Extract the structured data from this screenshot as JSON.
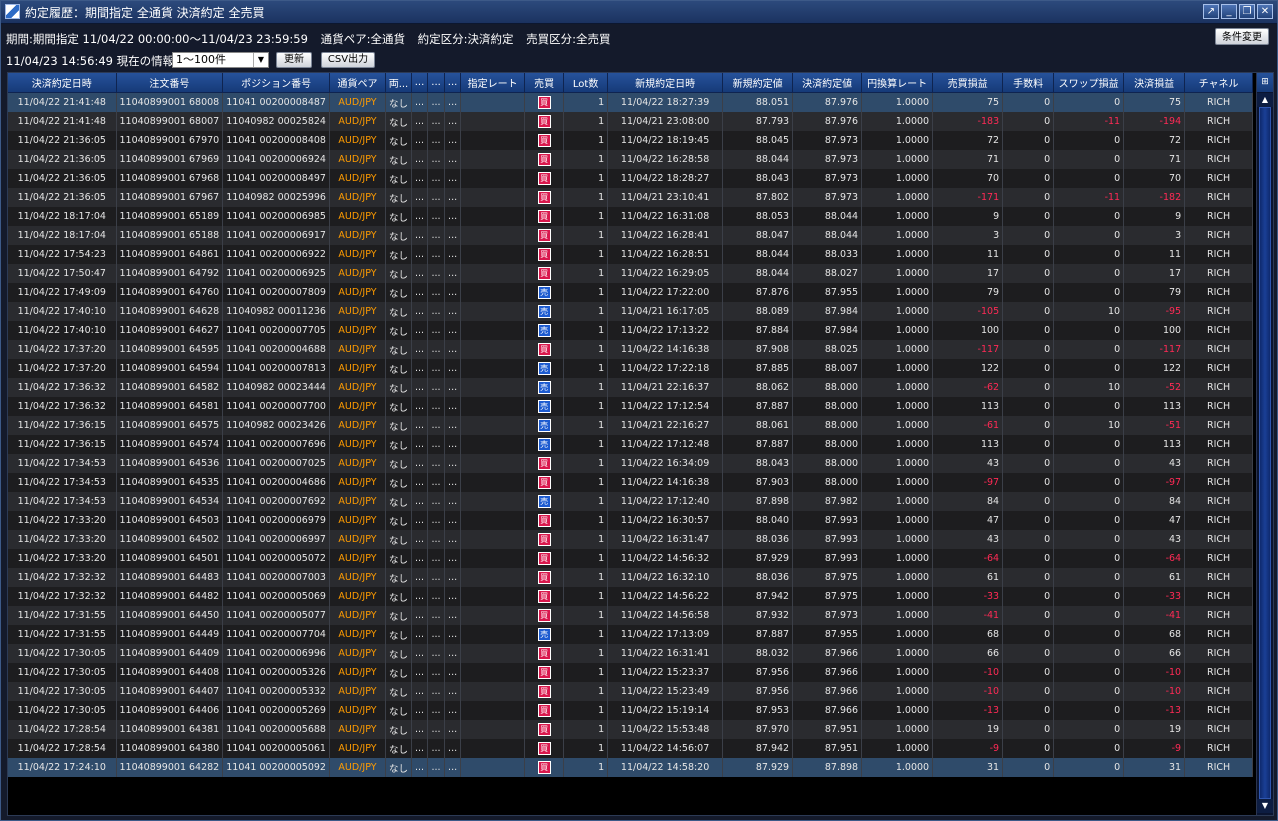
{
  "window": {
    "title": "約定履歴：期間指定 全通貨 決済約定 全売買",
    "buttons": [
      "↗",
      "_",
      "❐",
      "✕"
    ]
  },
  "info": {
    "period": "期間:期間指定  11/04/22 00:00:00〜11/04/23 23:59:59",
    "currency": "通貨ペア:全通貨",
    "contract_type": "約定区分:決済約定",
    "trade_type": "売買区分:全売買",
    "current": "11/04/23 14:56:49 現在の情報",
    "range": "1〜100件",
    "refresh_label": "更新",
    "csv_label": "CSV出力",
    "condition_label": "条件変更"
  },
  "table": {
    "columns": [
      "決済約定日時",
      "注文番号",
      "ポジション番号",
      "通貨ペア",
      "両...",
      "...",
      "...",
      "...",
      "指定レート",
      "売買",
      "Lot数",
      "新規約定日時",
      "新規約定値",
      "決済約定値",
      "円換算レート",
      "売買損益",
      "手数料",
      "スワップ損益",
      "決済損益",
      "チャネル"
    ],
    "rows": [
      [
        "11/04/22 21:41:48",
        "11040899001 68008",
        "11041 00200008487",
        "AUD/JPY",
        "なし",
        "...",
        "...",
        "...",
        "",
        "買",
        "1",
        "11/04/22 18:27:39",
        "88.051",
        "87.976",
        "1.0000",
        "75",
        "0",
        "0",
        "75",
        "RICH"
      ],
      [
        "11/04/22 21:41:48",
        "11040899001 68007",
        "11040982 00025824",
        "AUD/JPY",
        "なし",
        "...",
        "...",
        "...",
        "",
        "買",
        "1",
        "11/04/21 23:08:00",
        "87.793",
        "87.976",
        "1.0000",
        "-183",
        "0",
        "-11",
        "-194",
        "RICH"
      ],
      [
        "11/04/22 21:36:05",
        "11040899001 67970",
        "11041 00200008408",
        "AUD/JPY",
        "なし",
        "...",
        "...",
        "...",
        "",
        "買",
        "1",
        "11/04/22 18:19:45",
        "88.045",
        "87.973",
        "1.0000",
        "72",
        "0",
        "0",
        "72",
        "RICH"
      ],
      [
        "11/04/22 21:36:05",
        "11040899001 67969",
        "11041 00200006924",
        "AUD/JPY",
        "なし",
        "...",
        "...",
        "...",
        "",
        "買",
        "1",
        "11/04/22 16:28:58",
        "88.044",
        "87.973",
        "1.0000",
        "71",
        "0",
        "0",
        "71",
        "RICH"
      ],
      [
        "11/04/22 21:36:05",
        "11040899001 67968",
        "11041 00200008497",
        "AUD/JPY",
        "なし",
        "...",
        "...",
        "...",
        "",
        "買",
        "1",
        "11/04/22 18:28:27",
        "88.043",
        "87.973",
        "1.0000",
        "70",
        "0",
        "0",
        "70",
        "RICH"
      ],
      [
        "11/04/22 21:36:05",
        "11040899001 67967",
        "11040982 00025996",
        "AUD/JPY",
        "なし",
        "...",
        "...",
        "...",
        "",
        "買",
        "1",
        "11/04/21 23:10:41",
        "87.802",
        "87.973",
        "1.0000",
        "-171",
        "0",
        "-11",
        "-182",
        "RICH"
      ],
      [
        "11/04/22 18:17:04",
        "11040899001 65189",
        "11041 00200006985",
        "AUD/JPY",
        "なし",
        "...",
        "...",
        "...",
        "",
        "買",
        "1",
        "11/04/22 16:31:08",
        "88.053",
        "88.044",
        "1.0000",
        "9",
        "0",
        "0",
        "9",
        "RICH"
      ],
      [
        "11/04/22 18:17:04",
        "11040899001 65188",
        "11041 00200006917",
        "AUD/JPY",
        "なし",
        "...",
        "...",
        "...",
        "",
        "買",
        "1",
        "11/04/22 16:28:41",
        "88.047",
        "88.044",
        "1.0000",
        "3",
        "0",
        "0",
        "3",
        "RICH"
      ],
      [
        "11/04/22 17:54:23",
        "11040899001 64861",
        "11041 00200006922",
        "AUD/JPY",
        "なし",
        "...",
        "...",
        "...",
        "",
        "買",
        "1",
        "11/04/22 16:28:51",
        "88.044",
        "88.033",
        "1.0000",
        "11",
        "0",
        "0",
        "11",
        "RICH"
      ],
      [
        "11/04/22 17:50:47",
        "11040899001 64792",
        "11041 00200006925",
        "AUD/JPY",
        "なし",
        "...",
        "...",
        "...",
        "",
        "買",
        "1",
        "11/04/22 16:29:05",
        "88.044",
        "88.027",
        "1.0000",
        "17",
        "0",
        "0",
        "17",
        "RICH"
      ],
      [
        "11/04/22 17:49:09",
        "11040899001 64760",
        "11041 00200007809",
        "AUD/JPY",
        "なし",
        "...",
        "...",
        "...",
        "",
        "売",
        "1",
        "11/04/22 17:22:00",
        "87.876",
        "87.955",
        "1.0000",
        "79",
        "0",
        "0",
        "79",
        "RICH"
      ],
      [
        "11/04/22 17:40:10",
        "11040899001 64628",
        "11040982 00011236",
        "AUD/JPY",
        "なし",
        "...",
        "...",
        "...",
        "",
        "売",
        "1",
        "11/04/21 16:17:05",
        "88.089",
        "87.984",
        "1.0000",
        "-105",
        "0",
        "10",
        "-95",
        "RICH"
      ],
      [
        "11/04/22 17:40:10",
        "11040899001 64627",
        "11041 00200007705",
        "AUD/JPY",
        "なし",
        "...",
        "...",
        "...",
        "",
        "売",
        "1",
        "11/04/22 17:13:22",
        "87.884",
        "87.984",
        "1.0000",
        "100",
        "0",
        "0",
        "100",
        "RICH"
      ],
      [
        "11/04/22 17:37:20",
        "11040899001 64595",
        "11041 00200004688",
        "AUD/JPY",
        "なし",
        "...",
        "...",
        "...",
        "",
        "買",
        "1",
        "11/04/22 14:16:38",
        "87.908",
        "88.025",
        "1.0000",
        "-117",
        "0",
        "0",
        "-117",
        "RICH"
      ],
      [
        "11/04/22 17:37:20",
        "11040899001 64594",
        "11041 00200007813",
        "AUD/JPY",
        "なし",
        "...",
        "...",
        "...",
        "",
        "売",
        "1",
        "11/04/22 17:22:18",
        "87.885",
        "88.007",
        "1.0000",
        "122",
        "0",
        "0",
        "122",
        "RICH"
      ],
      [
        "11/04/22 17:36:32",
        "11040899001 64582",
        "11040982 00023444",
        "AUD/JPY",
        "なし",
        "...",
        "...",
        "...",
        "",
        "売",
        "1",
        "11/04/21 22:16:37",
        "88.062",
        "88.000",
        "1.0000",
        "-62",
        "0",
        "10",
        "-52",
        "RICH"
      ],
      [
        "11/04/22 17:36:32",
        "11040899001 64581",
        "11041 00200007700",
        "AUD/JPY",
        "なし",
        "...",
        "...",
        "...",
        "",
        "売",
        "1",
        "11/04/22 17:12:54",
        "87.887",
        "88.000",
        "1.0000",
        "113",
        "0",
        "0",
        "113",
        "RICH"
      ],
      [
        "11/04/22 17:36:15",
        "11040899001 64575",
        "11040982 00023426",
        "AUD/JPY",
        "なし",
        "...",
        "...",
        "...",
        "",
        "売",
        "1",
        "11/04/21 22:16:27",
        "88.061",
        "88.000",
        "1.0000",
        "-61",
        "0",
        "10",
        "-51",
        "RICH"
      ],
      [
        "11/04/22 17:36:15",
        "11040899001 64574",
        "11041 00200007696",
        "AUD/JPY",
        "なし",
        "...",
        "...",
        "...",
        "",
        "売",
        "1",
        "11/04/22 17:12:48",
        "87.887",
        "88.000",
        "1.0000",
        "113",
        "0",
        "0",
        "113",
        "RICH"
      ],
      [
        "11/04/22 17:34:53",
        "11040899001 64536",
        "11041 00200007025",
        "AUD/JPY",
        "なし",
        "...",
        "...",
        "...",
        "",
        "買",
        "1",
        "11/04/22 16:34:09",
        "88.043",
        "88.000",
        "1.0000",
        "43",
        "0",
        "0",
        "43",
        "RICH"
      ],
      [
        "11/04/22 17:34:53",
        "11040899001 64535",
        "11041 00200004686",
        "AUD/JPY",
        "なし",
        "...",
        "...",
        "...",
        "",
        "買",
        "1",
        "11/04/22 14:16:38",
        "87.903",
        "88.000",
        "1.0000",
        "-97",
        "0",
        "0",
        "-97",
        "RICH"
      ],
      [
        "11/04/22 17:34:53",
        "11040899001 64534",
        "11041 00200007692",
        "AUD/JPY",
        "なし",
        "...",
        "...",
        "...",
        "",
        "売",
        "1",
        "11/04/22 17:12:40",
        "87.898",
        "87.982",
        "1.0000",
        "84",
        "0",
        "0",
        "84",
        "RICH"
      ],
      [
        "11/04/22 17:33:20",
        "11040899001 64503",
        "11041 00200006979",
        "AUD/JPY",
        "なし",
        "...",
        "...",
        "...",
        "",
        "買",
        "1",
        "11/04/22 16:30:57",
        "88.040",
        "87.993",
        "1.0000",
        "47",
        "0",
        "0",
        "47",
        "RICH"
      ],
      [
        "11/04/22 17:33:20",
        "11040899001 64502",
        "11041 00200006997",
        "AUD/JPY",
        "なし",
        "...",
        "...",
        "...",
        "",
        "買",
        "1",
        "11/04/22 16:31:47",
        "88.036",
        "87.993",
        "1.0000",
        "43",
        "0",
        "0",
        "43",
        "RICH"
      ],
      [
        "11/04/22 17:33:20",
        "11040899001 64501",
        "11041 00200005072",
        "AUD/JPY",
        "なし",
        "...",
        "...",
        "...",
        "",
        "買",
        "1",
        "11/04/22 14:56:32",
        "87.929",
        "87.993",
        "1.0000",
        "-64",
        "0",
        "0",
        "-64",
        "RICH"
      ],
      [
        "11/04/22 17:32:32",
        "11040899001 64483",
        "11041 00200007003",
        "AUD/JPY",
        "なし",
        "...",
        "...",
        "...",
        "",
        "買",
        "1",
        "11/04/22 16:32:10",
        "88.036",
        "87.975",
        "1.0000",
        "61",
        "0",
        "0",
        "61",
        "RICH"
      ],
      [
        "11/04/22 17:32:32",
        "11040899001 64482",
        "11041 00200005069",
        "AUD/JPY",
        "なし",
        "...",
        "...",
        "...",
        "",
        "買",
        "1",
        "11/04/22 14:56:22",
        "87.942",
        "87.975",
        "1.0000",
        "-33",
        "0",
        "0",
        "-33",
        "RICH"
      ],
      [
        "11/04/22 17:31:55",
        "11040899001 64450",
        "11041 00200005077",
        "AUD/JPY",
        "なし",
        "...",
        "...",
        "...",
        "",
        "買",
        "1",
        "11/04/22 14:56:58",
        "87.932",
        "87.973",
        "1.0000",
        "-41",
        "0",
        "0",
        "-41",
        "RICH"
      ],
      [
        "11/04/22 17:31:55",
        "11040899001 64449",
        "11041 00200007704",
        "AUD/JPY",
        "なし",
        "...",
        "...",
        "...",
        "",
        "売",
        "1",
        "11/04/22 17:13:09",
        "87.887",
        "87.955",
        "1.0000",
        "68",
        "0",
        "0",
        "68",
        "RICH"
      ],
      [
        "11/04/22 17:30:05",
        "11040899001 64409",
        "11041 00200006996",
        "AUD/JPY",
        "なし",
        "...",
        "...",
        "...",
        "",
        "買",
        "1",
        "11/04/22 16:31:41",
        "88.032",
        "87.966",
        "1.0000",
        "66",
        "0",
        "0",
        "66",
        "RICH"
      ],
      [
        "11/04/22 17:30:05",
        "11040899001 64408",
        "11041 00200005326",
        "AUD/JPY",
        "なし",
        "...",
        "...",
        "...",
        "",
        "買",
        "1",
        "11/04/22 15:23:37",
        "87.956",
        "87.966",
        "1.0000",
        "-10",
        "0",
        "0",
        "-10",
        "RICH"
      ],
      [
        "11/04/22 17:30:05",
        "11040899001 64407",
        "11041 00200005332",
        "AUD/JPY",
        "なし",
        "...",
        "...",
        "...",
        "",
        "買",
        "1",
        "11/04/22 15:23:49",
        "87.956",
        "87.966",
        "1.0000",
        "-10",
        "0",
        "0",
        "-10",
        "RICH"
      ],
      [
        "11/04/22 17:30:05",
        "11040899001 64406",
        "11041 00200005269",
        "AUD/JPY",
        "なし",
        "...",
        "...",
        "...",
        "",
        "買",
        "1",
        "11/04/22 15:19:14",
        "87.953",
        "87.966",
        "1.0000",
        "-13",
        "0",
        "0",
        "-13",
        "RICH"
      ],
      [
        "11/04/22 17:28:54",
        "11040899001 64381",
        "11041 00200005688",
        "AUD/JPY",
        "なし",
        "...",
        "...",
        "...",
        "",
        "買",
        "1",
        "11/04/22 15:53:48",
        "87.970",
        "87.951",
        "1.0000",
        "19",
        "0",
        "0",
        "19",
        "RICH"
      ],
      [
        "11/04/22 17:28:54",
        "11040899001 64380",
        "11041 00200005061",
        "AUD/JPY",
        "なし",
        "...",
        "...",
        "...",
        "",
        "買",
        "1",
        "11/04/22 14:56:07",
        "87.942",
        "87.951",
        "1.0000",
        "-9",
        "0",
        "0",
        "-9",
        "RICH"
      ],
      [
        "11/04/22 17:24:10",
        "11040899001 64282",
        "11041 00200005092",
        "AUD/JPY",
        "なし",
        "...",
        "...",
        "...",
        "",
        "買",
        "1",
        "11/04/22 14:58:20",
        "87.929",
        "87.898",
        "1.0000",
        "31",
        "0",
        "0",
        "31",
        "RICH"
      ]
    ]
  },
  "colors": {
    "buy": "#d9184d",
    "sell": "#1d5bd0",
    "negative": "#ff2a55",
    "currency_pair": "#ff9c00"
  }
}
